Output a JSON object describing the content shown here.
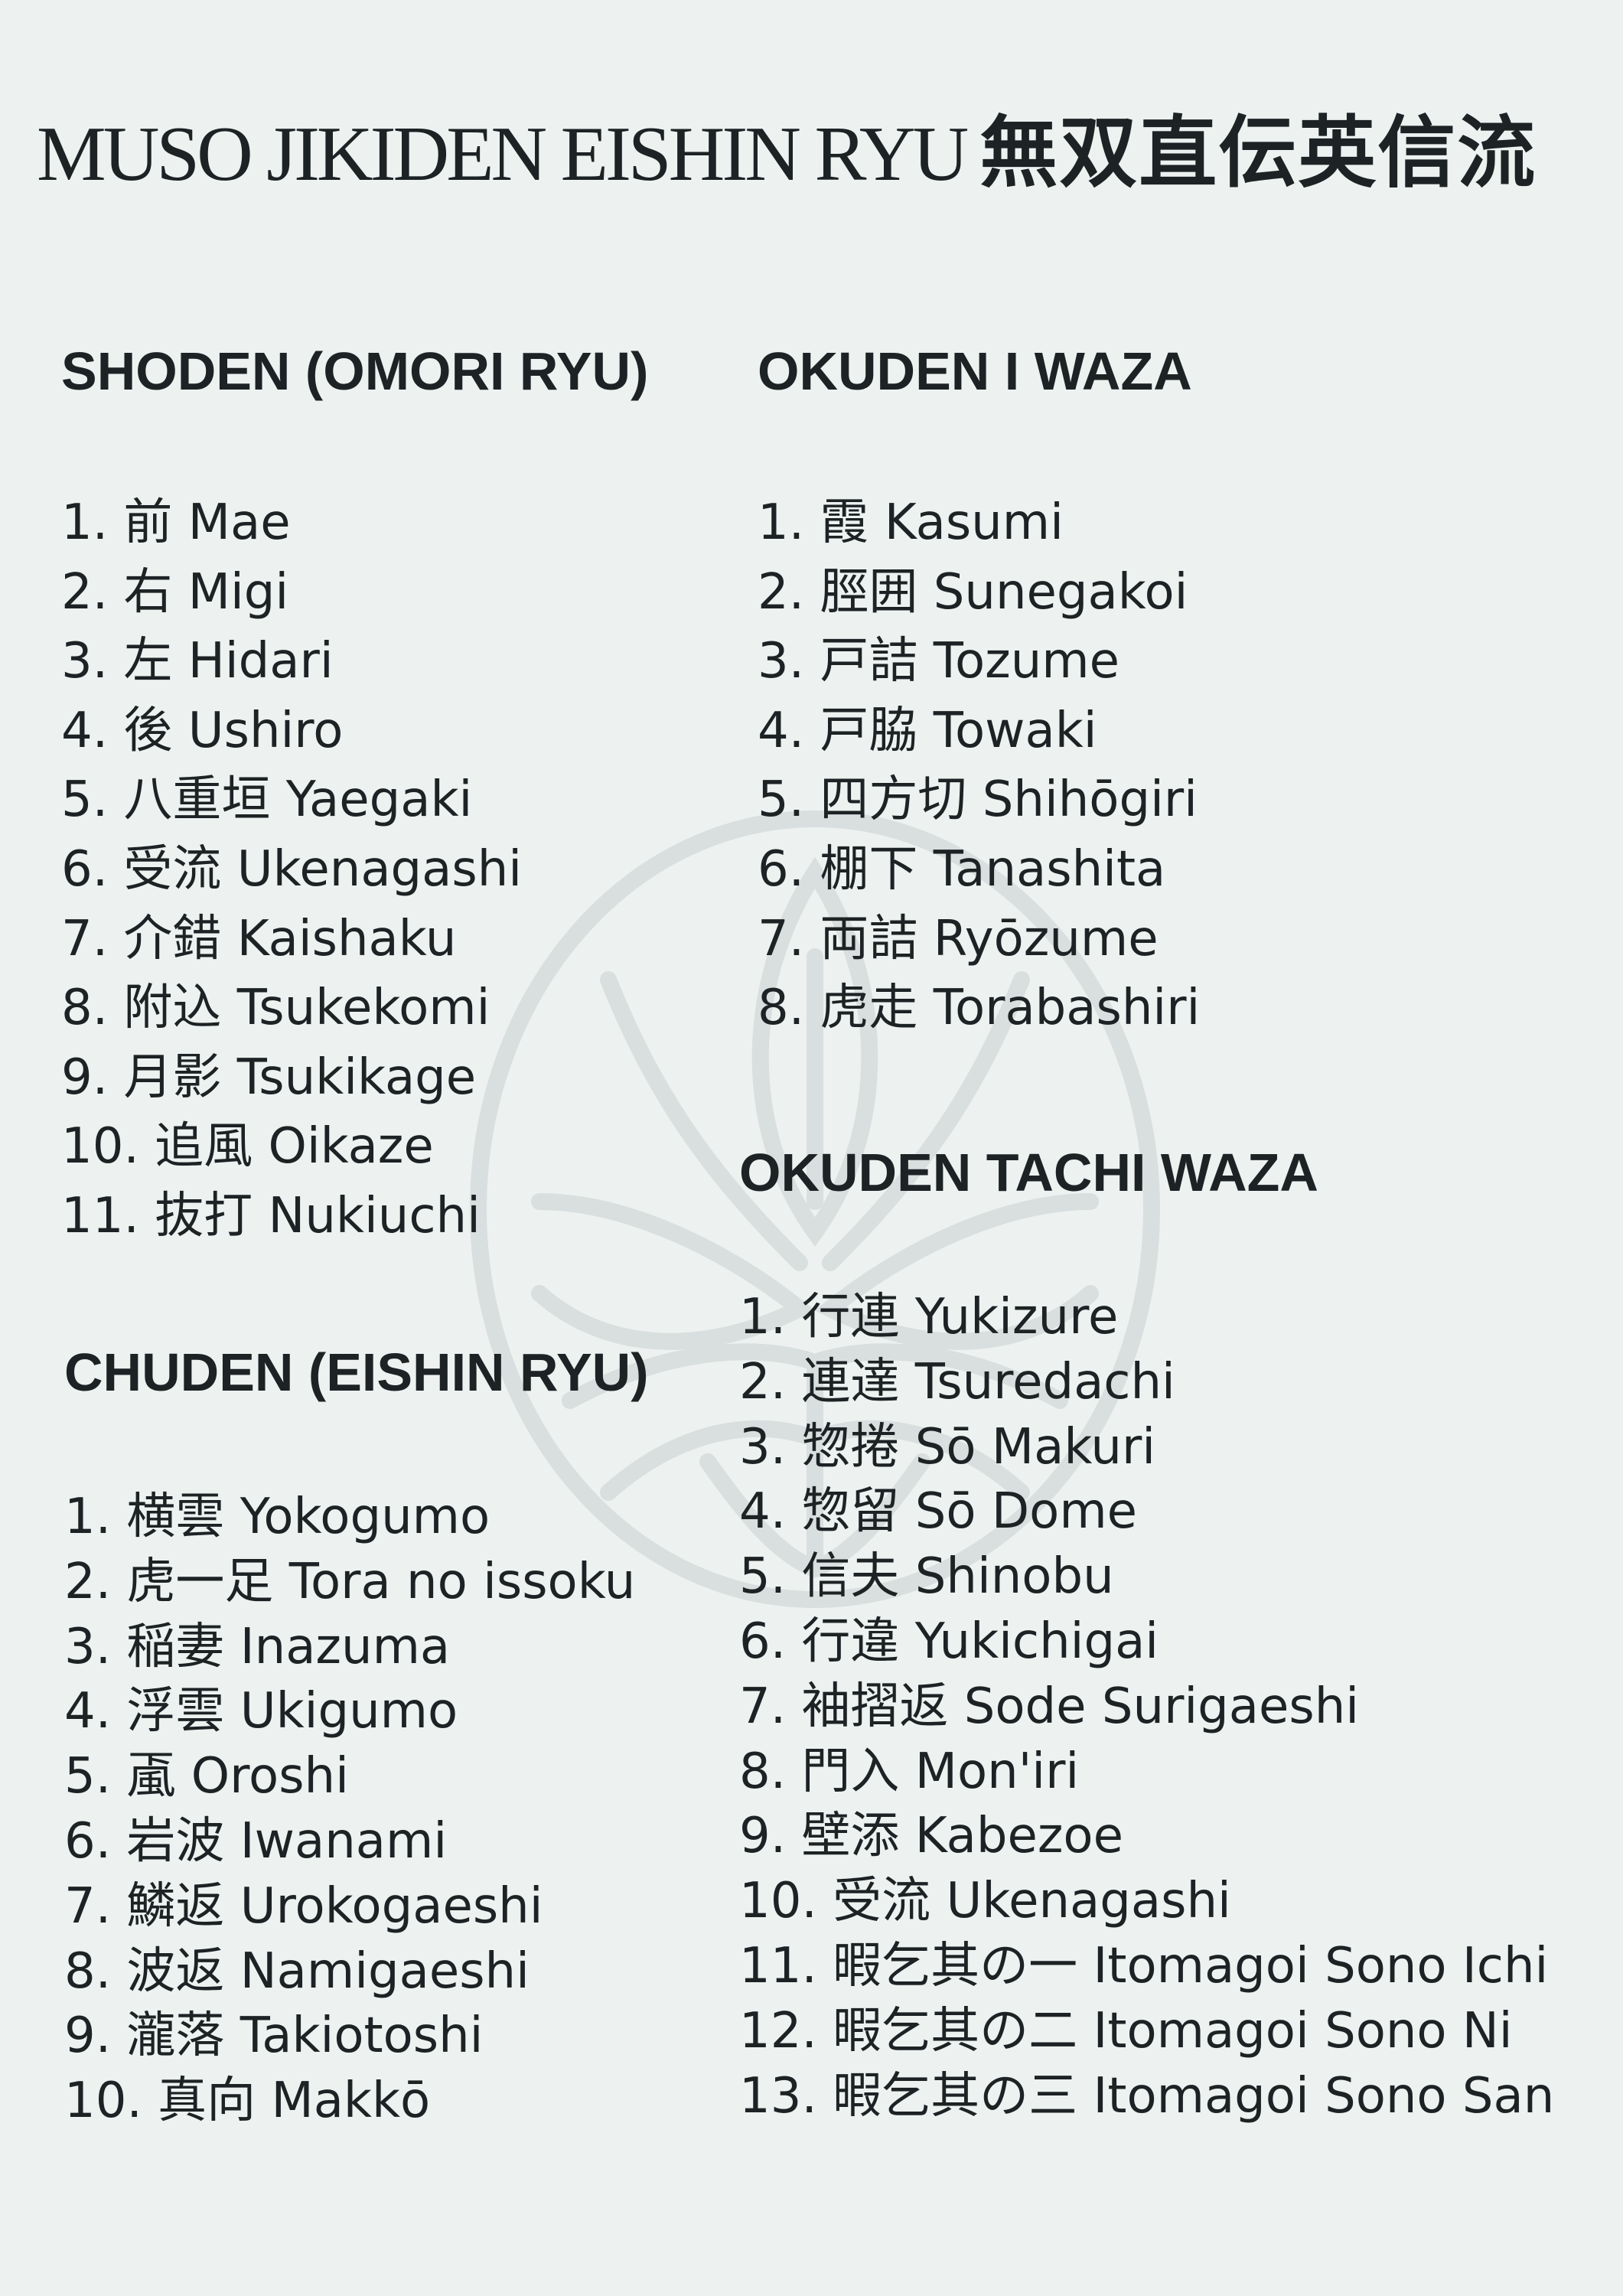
{
  "title": {
    "romaji": "MUSO JIKIDEN EISHIN RYU",
    "kanji": "無双直伝英信流"
  },
  "watermark": {
    "icon": "crest-emblem-icon",
    "color": "#d9dede"
  },
  "sections": {
    "shoden": {
      "heading": "SHODEN (OMORI RYU)",
      "items": [
        {
          "num": "1.",
          "kanji": "前",
          "romaji": "Mae"
        },
        {
          "num": "2.",
          "kanji": "右",
          "romaji": "Migi"
        },
        {
          "num": "3.",
          "kanji": "左",
          "romaji": "Hidari"
        },
        {
          "num": "4.",
          "kanji": "後",
          "romaji": "Ushiro"
        },
        {
          "num": "5.",
          "kanji": "八重垣",
          "romaji": "Yaegaki"
        },
        {
          "num": "6.",
          "kanji": "受流",
          "romaji": "Ukenagashi"
        },
        {
          "num": "7.",
          "kanji": "介錯",
          "romaji": "Kaishaku"
        },
        {
          "num": "8.",
          "kanji": "附込",
          "romaji": "Tsukekomi"
        },
        {
          "num": "9.",
          "kanji": "月影",
          "romaji": "Tsukikage"
        },
        {
          "num": "10.",
          "kanji": "追風",
          "romaji": "Oikaze"
        },
        {
          "num": "11.",
          "kanji": "抜打",
          "romaji": "Nukiuchi"
        }
      ]
    },
    "chuden": {
      "heading": "CHUDEN (EISHIN RYU)",
      "items": [
        {
          "num": "1.",
          "kanji": "横雲",
          "romaji": "Yokogumo"
        },
        {
          "num": "2.",
          "kanji": "虎一足",
          "romaji": "Tora no issoku"
        },
        {
          "num": "3.",
          "kanji": "稲妻",
          "romaji": "Inazuma"
        },
        {
          "num": "4.",
          "kanji": "浮雲",
          "romaji": "Ukigumo"
        },
        {
          "num": "5.",
          "kanji": "颪",
          "romaji": "Oroshi"
        },
        {
          "num": "6.",
          "kanji": "岩波",
          "romaji": "Iwanami"
        },
        {
          "num": "7.",
          "kanji": "鱗返",
          "romaji": "Urokogaeshi"
        },
        {
          "num": "8.",
          "kanji": "波返",
          "romaji": "Namigaeshi"
        },
        {
          "num": "9.",
          "kanji": "瀧落",
          "romaji": "Takiotoshi"
        },
        {
          "num": "10.",
          "kanji": "真向",
          "romaji": "Makkō"
        }
      ]
    },
    "okuden_i": {
      "heading": "OKUDEN I WAZA",
      "items": [
        {
          "num": "1.",
          "kanji": "霞",
          "romaji": "Kasumi"
        },
        {
          "num": "2.",
          "kanji": "脛囲",
          "romaji": "Sunegakoi"
        },
        {
          "num": "3.",
          "kanji": "戸詰",
          "romaji": "Tozume"
        },
        {
          "num": "4.",
          "kanji": "戸脇",
          "romaji": "Towaki"
        },
        {
          "num": "5.",
          "kanji": "四方切",
          "romaji": "Shihōgiri"
        },
        {
          "num": "6.",
          "kanji": "棚下",
          "romaji": "Tanashita"
        },
        {
          "num": "7.",
          "kanji": "両詰",
          "romaji": "Ryōzume"
        },
        {
          "num": "8.",
          "kanji": "虎走",
          "romaji": "Torabashiri"
        }
      ]
    },
    "okuden_tachi": {
      "heading": "OKUDEN TACHI WAZA",
      "items": [
        {
          "num": "1.",
          "kanji": "行連",
          "romaji": "Yukizure"
        },
        {
          "num": "2.",
          "kanji": "連達",
          "romaji": "Tsuredachi"
        },
        {
          "num": "3.",
          "kanji": "惣捲",
          "romaji": "Sō Makuri"
        },
        {
          "num": "4.",
          "kanji": "惣留",
          "romaji": "Sō Dome"
        },
        {
          "num": "5.",
          "kanji": "信夫",
          "romaji": "Shinobu"
        },
        {
          "num": "6.",
          "kanji": "行違",
          "romaji": "Yukichigai"
        },
        {
          "num": "7.",
          "kanji": "袖摺返",
          "romaji": "Sode Surigaeshi"
        },
        {
          "num": "8.",
          "kanji": "門入",
          "romaji": "Mon'iri"
        },
        {
          "num": "9.",
          "kanji": "壁添",
          "romaji": "Kabezoe"
        },
        {
          "num": "10.",
          "kanji": "受流",
          "romaji": "Ukenagashi"
        },
        {
          "num": "11.",
          "kanji": "暇乞其の一",
          "romaji": "Itomagoi Sono Ichi"
        },
        {
          "num": "12.",
          "kanji": "暇乞其の二",
          "romaji": "Itomagoi Sono Ni"
        },
        {
          "num": "13.",
          "kanji": "暇乞其の三",
          "romaji": "Itomagoi Sono San"
        }
      ]
    }
  }
}
